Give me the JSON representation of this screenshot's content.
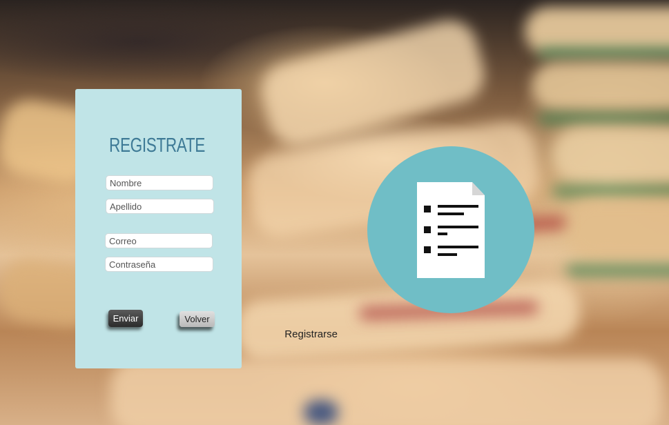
{
  "form": {
    "title": "REGISTRATE",
    "fields": {
      "nombre_placeholder": "Nombre",
      "apellido_placeholder": "Apellido",
      "correo_placeholder": "Correo",
      "contrasena_placeholder": "Contraseña"
    },
    "buttons": {
      "enviar_label": "Enviar",
      "volver_label": "Volver"
    }
  },
  "stray_text": "Registrarse",
  "illustration": {
    "icon": "document-list-icon",
    "circle_color": "#70bec6"
  },
  "colors": {
    "panel_bg": "#c0e4e7",
    "title": "#3e7a96"
  }
}
